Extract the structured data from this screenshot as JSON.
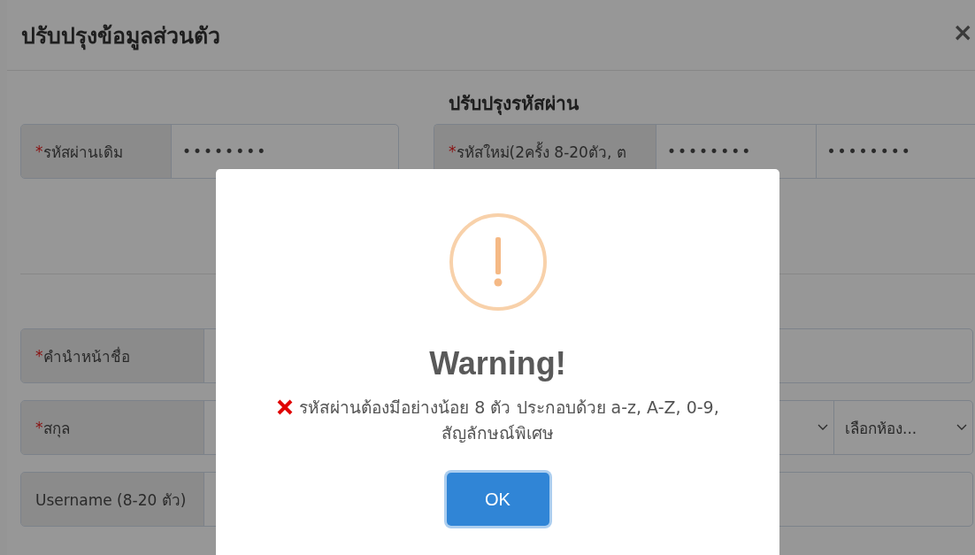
{
  "modal": {
    "title": "ปรับปรุงข้อมูลส่วนตัว",
    "close": "×"
  },
  "password_section": {
    "heading": "ปรับปรุงรหัสผ่าน",
    "old": {
      "mark": "*",
      "label": "รหัสผ่านเดิม",
      "value": "••••••••"
    },
    "new": {
      "mark": "*",
      "label": "รหัสใหม่(2ครั้ง 8-20ตัว, ต",
      "value": "••••••••",
      "confirm_value": "••••••••"
    }
  },
  "form_rows": [
    {
      "mark": "*",
      "label": "คำนำหน้าชื่อ",
      "kind": "title"
    },
    {
      "mark": "*",
      "label": "สกุล",
      "kind": "surname",
      "select_label": "เลือกห้อง..."
    },
    {
      "label": "Username (8-20 ตัว)",
      "kind": "username"
    }
  ],
  "dialog": {
    "title": "Warning!",
    "message": "รหัสผ่านต้องมีอย่างน้อย 8 ตัว ประกอบด้วย a-z, A-Z, 0-9, สัญลักษณ์พิเศษ",
    "button": "OK"
  }
}
